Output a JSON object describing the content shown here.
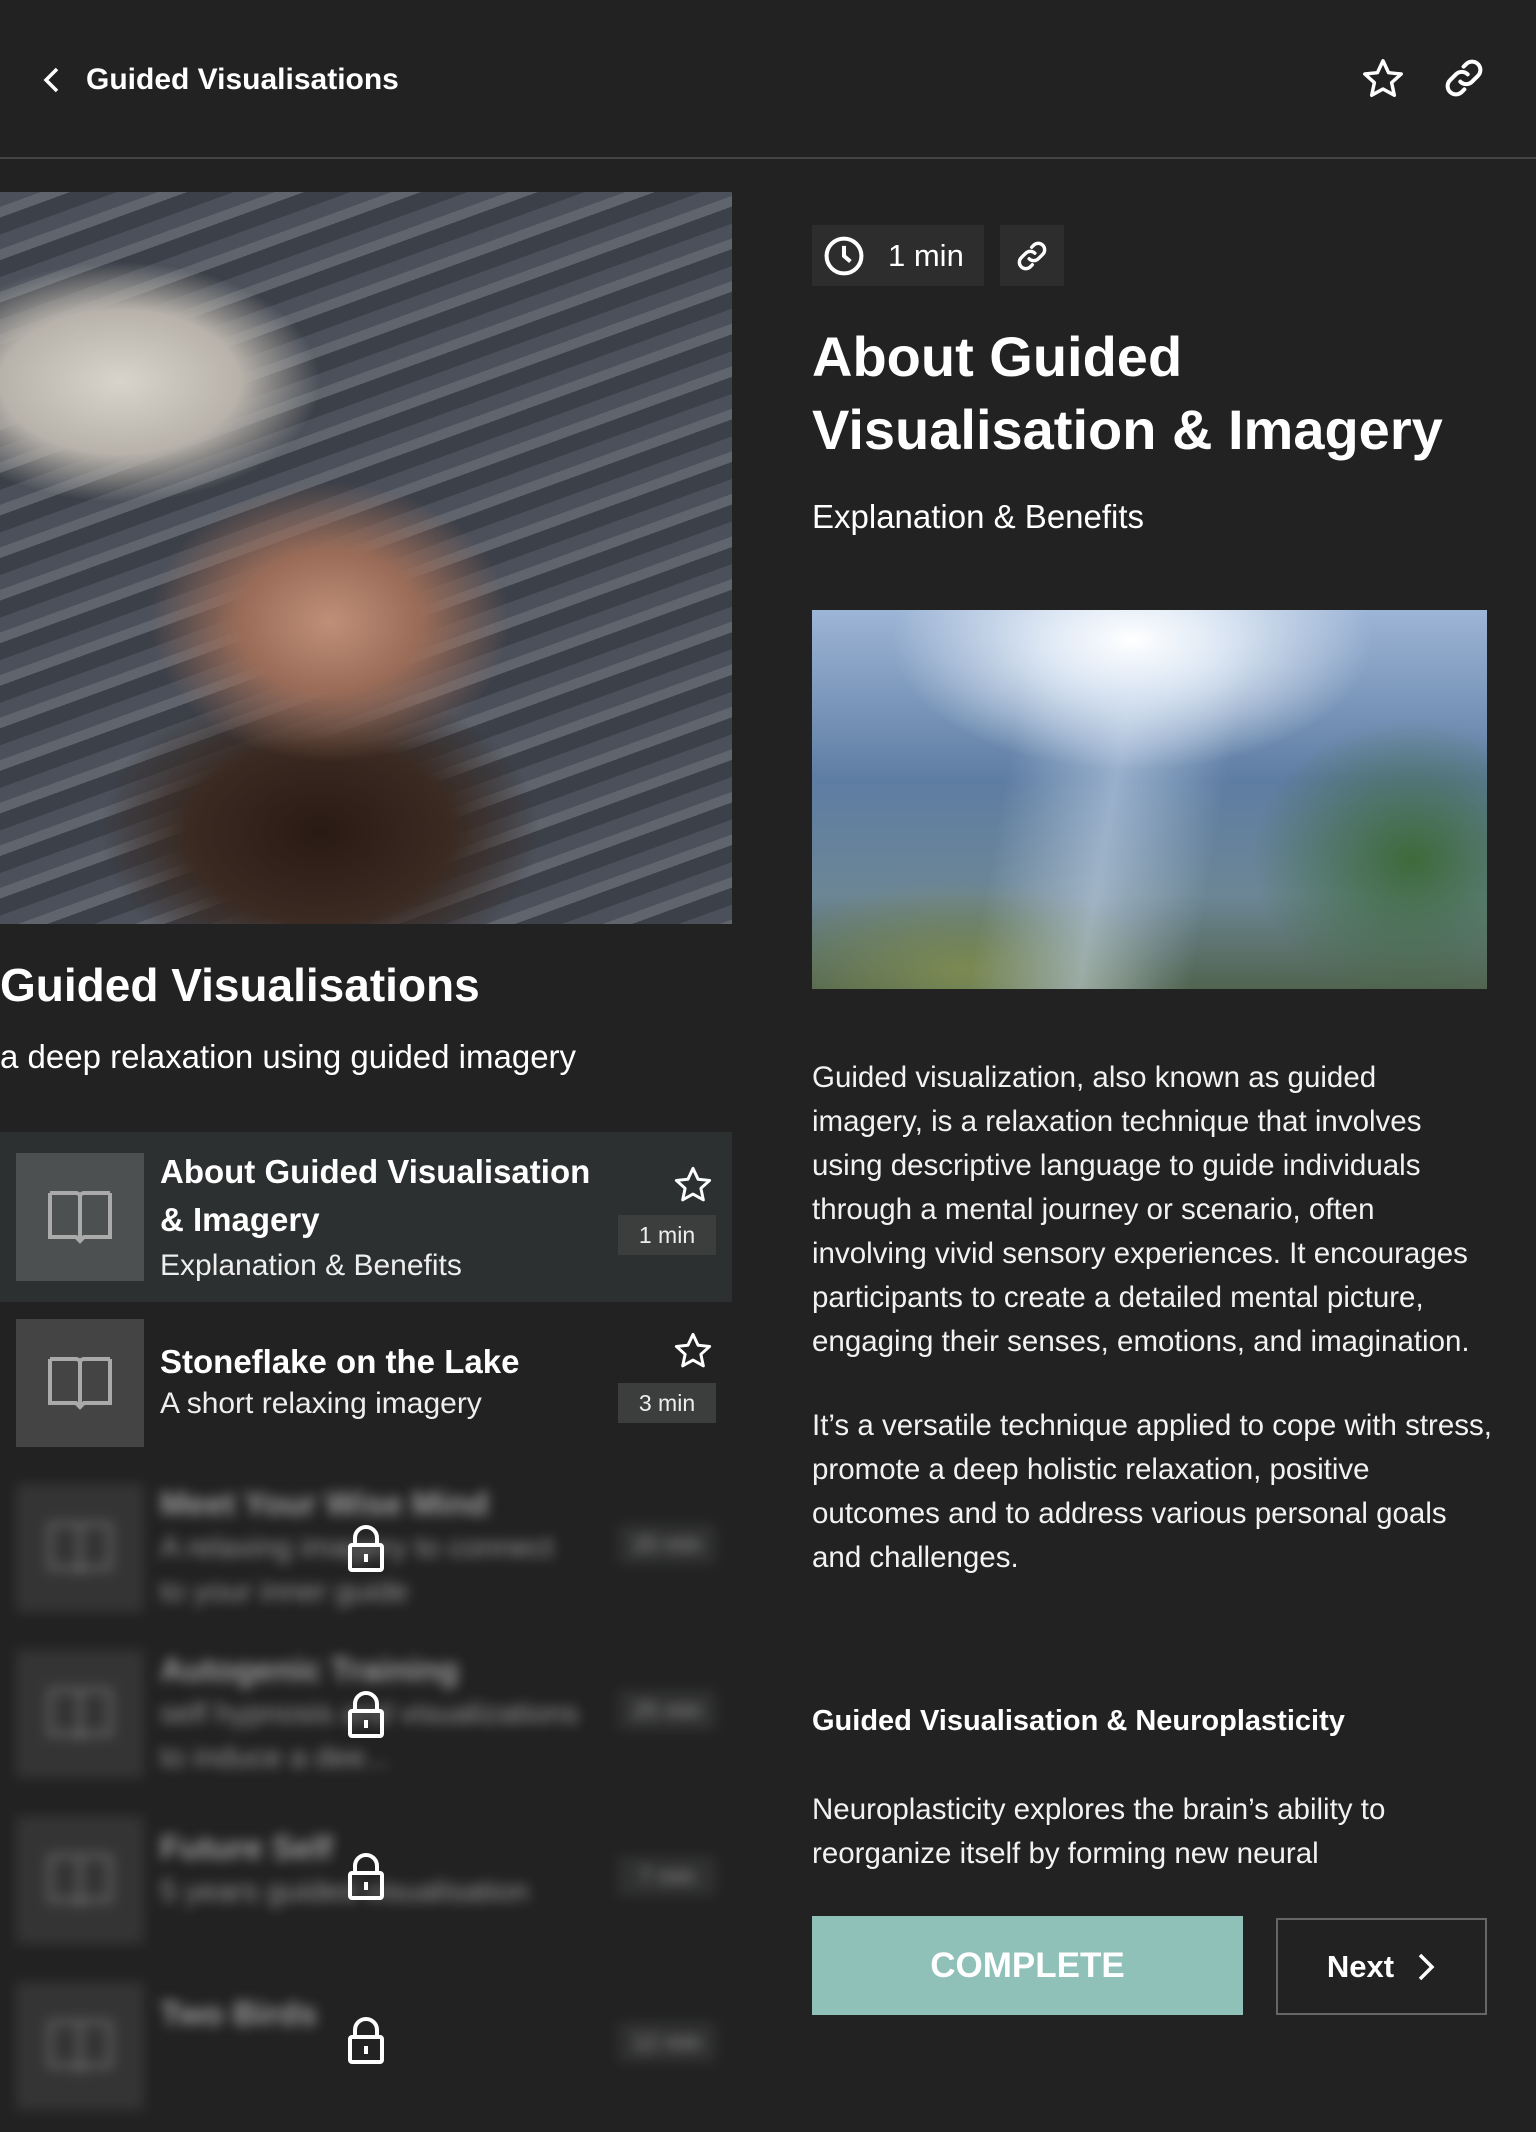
{
  "header": {
    "title": "Guided Visualisations",
    "back_icon": "chevron-left-icon",
    "favorite_icon": "star-icon",
    "share_icon": "link-icon"
  },
  "collection": {
    "title": "Guided Visualisations",
    "subtitle": "a deep relaxation using guided imagery"
  },
  "items": [
    {
      "title": "About Guided Visualisation & Imagery",
      "subtitle": "Explanation & Benefits",
      "duration": "1 min",
      "active": true,
      "locked": false
    },
    {
      "title": "Stoneflake on the Lake",
      "subtitle": "A short relaxing imagery",
      "duration": "3 min",
      "active": false,
      "locked": false
    },
    {
      "title": "Meet Your Wise Mind",
      "subtitle": "A relaxing imagery to connect to your inner guide",
      "duration": "20 min",
      "locked": true
    },
    {
      "title": "Autogenic Training",
      "subtitle": "self hypnosis and visualizations to induce a dee...",
      "duration": "25 min",
      "locked": true
    },
    {
      "title": "Future Self",
      "subtitle": "5 years guided visualisation",
      "duration": "7 min",
      "locked": true
    },
    {
      "title": "Two Birds",
      "subtitle": "",
      "duration": "12 min",
      "locked": true
    }
  ],
  "detail": {
    "duration": "1 min",
    "title": "About Guided Visualisation & Imagery",
    "subtitle": "Explanation & Benefits",
    "paragraph1": "Guided visualization, also known as guided imagery, is a relaxation technique that involves using descriptive language to guide individuals through a mental journey or scenario, often involving vivid sensory experiences. It encourages participants to create a detailed mental picture, engaging their senses, emotions, and imagination.",
    "paragraph2": "It’s a versatile technique applied to cope with stress, promote a deep holistic relaxation, positive outcomes and to address various personal goals and challenges.",
    "section_heading": "Guided Visualisation & Neuroplasticity",
    "paragraph3": "Neuroplasticity explores the brain’s ability to reorganize itself by forming new neural"
  },
  "actions": {
    "complete_label": "COMPLETE",
    "next_label": "Next"
  },
  "colors": {
    "background": "#222222",
    "accent": "#8fc1b9"
  }
}
